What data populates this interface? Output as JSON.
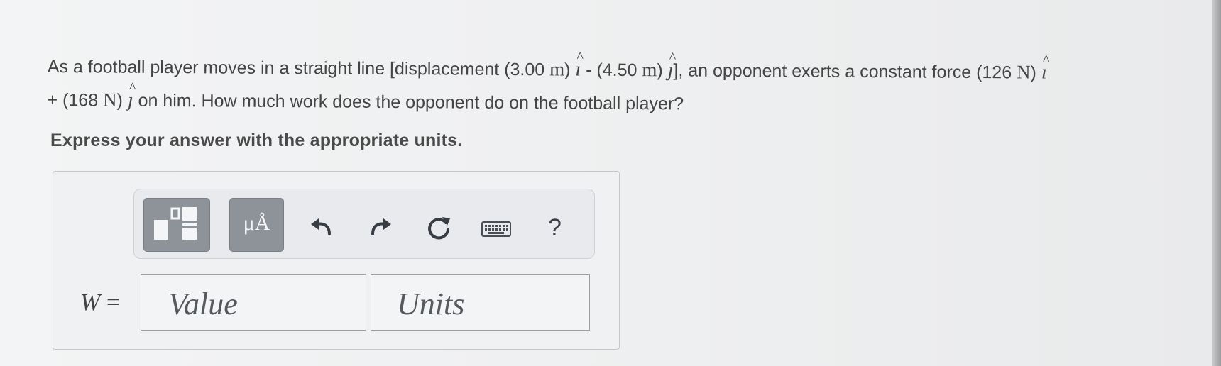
{
  "problem": {
    "line1_a": "As a football player moves in a straight line [displacement (3.00 ",
    "unit_m1": "m",
    "line1_b": ") ",
    "i_hat1": "ı",
    "line1_c": " - (4.50 ",
    "unit_m2": "m",
    "line1_d": ") ",
    "j_hat1": "ȷ",
    "line1_e": "], an opponent exerts a constant force (126 ",
    "unit_N1": "N",
    "line1_f": ") ",
    "i_hat2": "ı",
    "line2_a": "+ (168 ",
    "unit_N2": "N",
    "line2_b": ") ",
    "j_hat2": "ȷ",
    "line2_c": " on him. How much work does the opponent do on the football player?"
  },
  "instruction": "Express your answer with the appropriate units.",
  "toolbar": {
    "units_button_label": "μÅ",
    "help_label": "?"
  },
  "answer": {
    "variable": "W",
    "equals": "=",
    "value_placeholder": "Value",
    "units_placeholder": "Units"
  },
  "icons": [
    "templates-icon",
    "units-icon",
    "undo-icon",
    "redo-icon",
    "reset-icon",
    "keyboard-icon",
    "help-icon"
  ]
}
